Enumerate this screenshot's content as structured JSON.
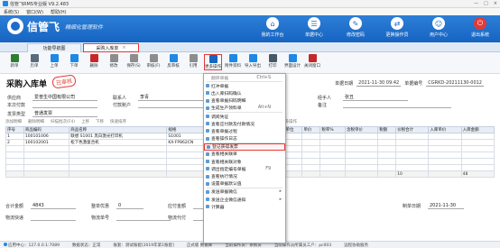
{
  "titlebar": {
    "title": "信管飞RMS专业版 V9.2.483"
  },
  "window_buttons": [
    "—",
    "□",
    "×"
  ],
  "menu": [
    "系统(S)",
    "窗口(W)",
    "帮助(H)"
  ],
  "banner": {
    "brand": "信管飞",
    "slogan": "精细化管理软件",
    "buttons": [
      {
        "icon": "home-icon",
        "label": "我的工作台"
      },
      {
        "icon": "list-icon",
        "label": "单据中心"
      },
      {
        "icon": "key-icon",
        "label": "修改密码"
      },
      {
        "icon": "user-switch-icon",
        "label": "更换操作员"
      },
      {
        "icon": "customer-icon",
        "label": "用户中心"
      },
      {
        "icon": "power-icon",
        "label": "退出系统"
      }
    ]
  },
  "tabs": [
    {
      "label": "功能导航图"
    },
    {
      "label": "采购入库单",
      "close": "×"
    }
  ],
  "toolbar": [
    {
      "icon": "new-icon",
      "label": "新单",
      "color": "#2e7d32"
    },
    {
      "icon": "history-icon",
      "label": "历单",
      "color": "#5b6b7b"
    },
    {
      "icon": "prev-icon",
      "label": "上单",
      "color": "#1e88e5"
    },
    {
      "icon": "next-icon",
      "label": "下单",
      "color": "#1e88e5"
    },
    {
      "icon": "delete-icon",
      "label": "删除",
      "color": "#c62828"
    },
    {
      "icon": "modify-icon",
      "label": "修改",
      "color": "#8d8d8d"
    },
    {
      "icon": "save-icon",
      "label": "保存(S)",
      "color": "#8d8d8d"
    },
    {
      "icon": "audit-icon",
      "label": "审核(F)",
      "color": "#8d8d8d"
    },
    {
      "icon": "unaudit-icon",
      "label": "反审核",
      "color": "#1e88e5"
    },
    {
      "icon": "reference-icon",
      "label": "引用",
      "color": "#8d8d8d"
    },
    {
      "icon": "more-ops-icon",
      "label": "更多操作",
      "color": "#1565c0"
    },
    {
      "icon": "attachment-icon",
      "label": "附件资料",
      "color": "#1e88e5"
    },
    {
      "icon": "import-icon",
      "label": "导入导出",
      "color": "#1e88e5"
    },
    {
      "icon": "print-icon",
      "label": "打印",
      "color": "#455a64"
    },
    {
      "icon": "design-icon",
      "label": "界面设计",
      "color": "#1e88e5"
    },
    {
      "icon": "close-doc-icon",
      "label": "关闭窗口",
      "color": "#c62828"
    }
  ],
  "document": {
    "title": "采购入库单",
    "stamp": "已审核",
    "date_label": "单据日期",
    "date": "2021-11-30 09:42",
    "no_label": "单据编号",
    "no": "CGRKD-20211130-0012"
  },
  "header_fields": [
    {
      "label": "供应商",
      "value": "爱普生中国有限公司"
    },
    {
      "label": "本次付款",
      "value": ""
    },
    {
      "label": "发票类型",
      "value": "普通发票"
    }
  ],
  "header_fields_mid": [
    {
      "label": "联系人",
      "value": "李青"
    },
    {
      "label": "付款账户",
      "value": ""
    }
  ],
  "header_fields_right": [
    {
      "label": "经手人",
      "value": "张丑"
    },
    {
      "label": "备注",
      "value": ""
    }
  ],
  "grid_tools": [
    "添加明细",
    "删除明细",
    "扫描批次(F4)",
    "上移",
    "下移",
    "快速排序",
    "查看商品详情",
    "更多操作"
  ],
  "grid": {
    "headers": [
      "序号",
      "商品编码",
      "商品名称",
      "规格",
      "批号",
      "仓库",
      "入库数量",
      "单位",
      "单价",
      "税率%",
      "含税单价",
      "税额",
      "价税合计",
      "入库单价",
      "入库金额"
    ],
    "rows": [
      [
        "1",
        "100101006",
        "联想 S1001 黑白激光打印机",
        "S1001",
        "",
        "台",
        "",
        "",
        "",
        "",
        "",
        "",
        "",
        "",
        ""
      ],
      [
        "2",
        "100102001",
        "松下色激复合机",
        "KX-FP862CN",
        "",
        "台",
        "",
        "",
        "",
        "",
        "",
        "",
        "",
        "",
        ""
      ]
    ],
    "sum": [
      "",
      "",
      "",
      "",
      "",
      "",
      "",
      "",
      "",
      "",
      "",
      "",
      "10",
      "",
      "48"
    ]
  },
  "bottom": {
    "total_label": "合计金额",
    "total": "4843",
    "discount_label": "整单优惠",
    "discount": "0",
    "due_label": "应付金额",
    "logistics_label": "物流快递",
    "logistics_no_label": "物流单号",
    "logistics_fee_label": "物流代付",
    "maker_label": "制单日期",
    "maker_date": "2021-11-30"
  },
  "dropdown": {
    "header": "翻转单据",
    "header_sc": "Ctrl+S",
    "items": [
      {
        "label": "红冲单据"
      },
      {
        "label": "出入库扫码确认"
      },
      {
        "label": "查看单据扫码明细"
      },
      {
        "label": "生成生产领料单",
        "sc": "Alt+N"
      },
      {
        "label": "调阅凭证"
      },
      {
        "label": "查看应付款及付款情况"
      },
      {
        "label": "查看单据过程"
      },
      {
        "label": "查看操作日志"
      },
      {
        "label": "登记获得发票",
        "hl": true
      },
      {
        "label": "查看相关联单"
      },
      {
        "label": "查看相关联对象"
      },
      {
        "label": "调出指定编号单据",
        "sc": "F9"
      },
      {
        "label": "查看执行情况"
      },
      {
        "label": "设置单据默认值"
      },
      {
        "label": "发送单据微信",
        "arr": "▸"
      },
      {
        "label": "发送企业微信通知",
        "arr": "▸"
      },
      {
        "label": "计算器"
      }
    ]
  },
  "status": {
    "server": "应用中心：127.0.0.1:7089",
    "db": "数据状态：正常",
    "account": "账套：测试账套[2019年第1账套]",
    "edition": "正式版 数据库",
    "op": "当前操作员：系统员",
    "opfull": "当前操作员所属员工户：pc003",
    "assist": "远程协助服务"
  }
}
